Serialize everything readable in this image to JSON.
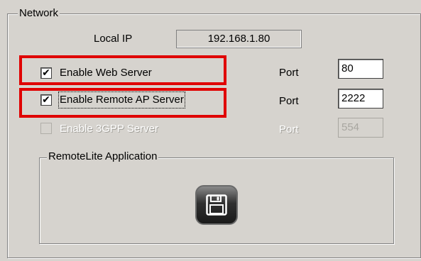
{
  "network": {
    "title": "Network",
    "local_ip_label": "Local IP",
    "local_ip_value": "192.168.1.80",
    "servers": [
      {
        "label": "Enable Web Server",
        "checked": true,
        "enabled": true,
        "port_label": "Port",
        "port_value": "80",
        "highlighted": true
      },
      {
        "label": "Enable Remote AP Server",
        "checked": true,
        "enabled": true,
        "port_label": "Port",
        "port_value": "2222",
        "highlighted": true,
        "focused": true
      },
      {
        "label": "Enable 3GPP Server",
        "checked": false,
        "enabled": false,
        "port_label": "Port",
        "port_value": "554"
      }
    ],
    "check_mark": "✔"
  },
  "app_group": {
    "title": "RemoteLite Application",
    "save_icon": "floppy-disk-icon"
  },
  "colors": {
    "panel_bg": "#d6d3ce",
    "highlight_border": "#e00000",
    "disabled_text": "#ffffff"
  }
}
